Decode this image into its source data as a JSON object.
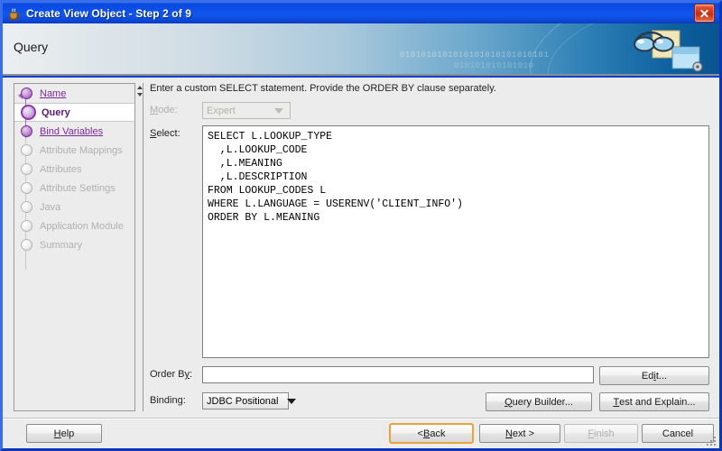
{
  "window": {
    "title": "Create View Object - Step 2 of 9",
    "icon": "java-coffee-cup-icon",
    "close_label": "",
    "banner_title": "Query",
    "banner_binary_1": "0101010101010101010101010101",
    "banner_binary_2": "010101010101010",
    "banner_art": "glasses-and-window-icon"
  },
  "sidebar": {
    "items": [
      {
        "label": "Name",
        "state": "done"
      },
      {
        "label": "Query",
        "state": "current"
      },
      {
        "label": "Bind Variables",
        "state": "done"
      },
      {
        "label": "Attribute Mappings",
        "state": "todo"
      },
      {
        "label": "Attributes",
        "state": "todo"
      },
      {
        "label": "Attribute Settings",
        "state": "todo"
      },
      {
        "label": "Java",
        "state": "todo"
      },
      {
        "label": "Application Module",
        "state": "todo"
      },
      {
        "label": "Summary",
        "state": "todo"
      }
    ]
  },
  "content": {
    "instruction": "Enter a custom SELECT statement. Provide the ORDER BY clause separately.",
    "mode": {
      "label_pre": "",
      "label_mn": "M",
      "label_post": "ode:",
      "value": "Expert",
      "options": [
        "Expert"
      ],
      "disabled": true
    },
    "select": {
      "label_pre": "",
      "label_mn": "S",
      "label_post": "elect:",
      "value": "SELECT L.LOOKUP_TYPE\n  ,L.LOOKUP_CODE\n  ,L.MEANING\n  ,L.DESCRIPTION\nFROM LOOKUP_CODES L\nWHERE L.LANGUAGE = USERENV('CLIENT_INFO')\nORDER BY L.MEANING"
    },
    "order_by": {
      "label_pre": "Order B",
      "label_mn": "y",
      "label_post": ":",
      "value": "",
      "placeholder": ""
    },
    "binding": {
      "label_pre": "Binding:",
      "label_mn": "",
      "label_post": "",
      "value": "JDBC Positional",
      "options": [
        "JDBC Positional"
      ]
    },
    "buttons": {
      "edit": {
        "pre": "Ed",
        "mn": "i",
        "post": "t..."
      },
      "query_builder": {
        "pre": "",
        "mn": "Q",
        "post": "uery Builder..."
      },
      "test_explain": {
        "pre": "",
        "mn": "T",
        "post": "est and Explain..."
      }
    }
  },
  "footer": {
    "help": {
      "pre": "",
      "mn": "H",
      "post": "elp",
      "state": "enabled"
    },
    "back": {
      "pre": "< ",
      "mn": "B",
      "post": "ack",
      "state": "focused"
    },
    "next": {
      "pre": "",
      "mn": "N",
      "post": "ext >",
      "state": "enabled"
    },
    "finish": {
      "pre": "",
      "mn": "F",
      "post": "inish",
      "state": "disabled"
    },
    "cancel": {
      "pre": "Cancel",
      "mn": "",
      "post": "",
      "state": "enabled"
    }
  }
}
